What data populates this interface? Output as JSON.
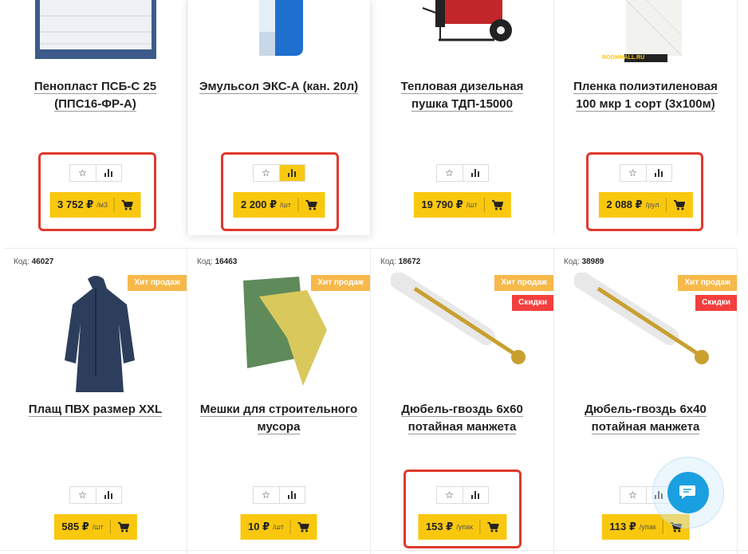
{
  "products_row1": [
    {
      "title": "Пенопласт ПСБ-С 25 (ППС16-ФР-А)",
      "price": "3 752 ₽",
      "unit": "/м3"
    },
    {
      "title": "Эмульсол ЭКС-А (кан. 20л)",
      "price": "2 200 ₽",
      "unit": "/шт"
    },
    {
      "title": "Тепловая дизельная пушка ТДП-15000",
      "price": "19 790 ₽",
      "unit": "/шт"
    },
    {
      "title": "Пленка полиэтиленовая 100 мкр 1 сорт (3х100м)",
      "price": "2 088 ₽",
      "unit": "/рул"
    }
  ],
  "products_row2": [
    {
      "code_label": "Код:",
      "code": "46027",
      "badge_hit": "Хит продаж",
      "title": "Плащ ПВХ размер XXL",
      "price": "585 ₽",
      "unit": "/шт"
    },
    {
      "code_label": "Код:",
      "code": "16463",
      "badge_hit": "Хит продаж",
      "title": "Мешки для строительного мусора",
      "price": "10 ₽",
      "unit": "/шт"
    },
    {
      "code_label": "Код:",
      "code": "18672",
      "badge_hit": "Хит продаж",
      "badge_sale": "Скидки",
      "title": "Дюбель-гвоздь 6х60 потайная манжета",
      "price": "153 ₽",
      "unit": "/упак"
    },
    {
      "code_label": "Код:",
      "code": "38989",
      "badge_hit": "Хит продаж",
      "badge_sale": "Скидки",
      "title": "Дюбель-гвоздь 6х40 потайная манжета",
      "price": "113 ₽",
      "unit": "/упак"
    }
  ],
  "film_brand": "ROOMMALL.RU",
  "icons": {
    "favorite": "star-icon",
    "compare": "bar-chart-icon",
    "cart": "cart-icon",
    "chat": "chat-bubble-icon"
  },
  "colors": {
    "accent": "#f9c80e",
    "hit_badge": "#f7b94a",
    "sale_badge": "#f33e3e",
    "highlight": "#e0392d",
    "chat": "#1a9fe0"
  }
}
